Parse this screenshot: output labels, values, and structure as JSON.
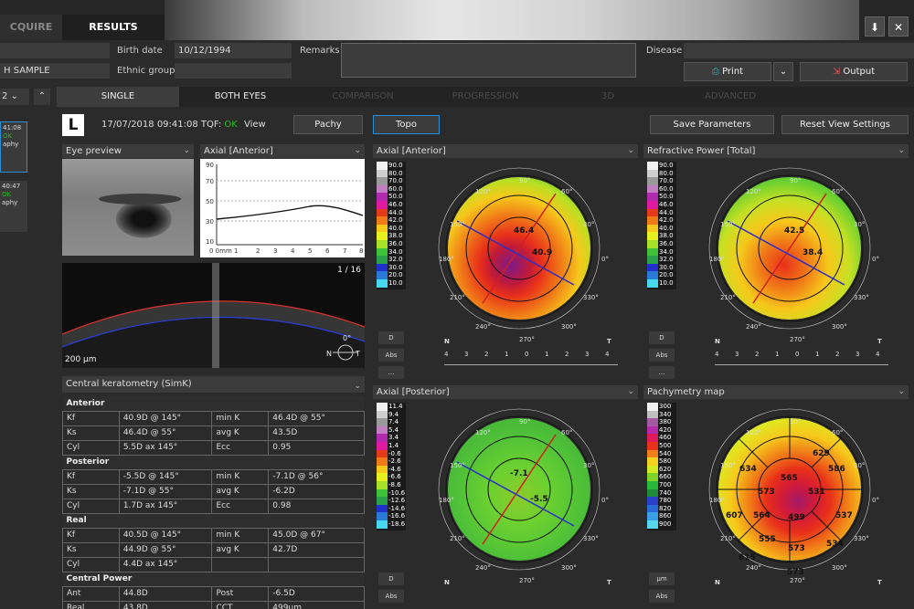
{
  "topbar": {
    "tab_acquire": "CQUIRE",
    "tab_results": "RESULTS",
    "download_icon": "⬇",
    "close_icon": "✕"
  },
  "patient": {
    "birth_label": "Birth date",
    "birth_value": "10/12/1994",
    "ethnic_label": "Ethnic group",
    "remarks_label": "Remarks",
    "disease_label": "Disease",
    "name_value": "H SAMPLE",
    "print_label": "Print",
    "output_label": "Output"
  },
  "nav": {
    "tabs": [
      "SINGLE",
      "BOTH EYES",
      "COMPARISON",
      "PROGRESSION",
      "3D",
      "ADVANCED"
    ],
    "exam_selector": "2",
    "thumb1": {
      "time": "41:08",
      "status": "OK",
      "type": "aphy"
    },
    "thumb2": {
      "time": "40:47",
      "status": "OK",
      "type": "aphy"
    }
  },
  "header": {
    "eye": "L",
    "datetime": "17/07/2018 09:41:08 TQF:",
    "tqf": "OK",
    "view": "View",
    "pachy": "Pachy",
    "topo": "Topo",
    "save": "Save Parameters",
    "reset": "Reset View Settings"
  },
  "eye_preview": {
    "title": "Eye preview"
  },
  "profile": {
    "title": "Axial [Anterior]",
    "y_ticks": [
      "90",
      "70",
      "50",
      "30",
      "10"
    ],
    "x_ticks": [
      "0 0mm 1",
      "2",
      "3",
      "4",
      "5",
      "6",
      "7",
      "8"
    ]
  },
  "oct": {
    "frame": "1 / 16",
    "scale": "200 µm",
    "angle": "0°",
    "nasal": "N",
    "temporal": "T"
  },
  "simk": {
    "title": "Central keratometry (SimK)",
    "sections": [
      {
        "name": "Anterior",
        "rows": [
          [
            "Kf",
            "40.9D @ 145°",
            "min K",
            "46.4D @ 55°"
          ],
          [
            "Ks",
            "46.4D @ 55°",
            "avg K",
            "43.5D"
          ],
          [
            "Cyl",
            "5.5D ax 145°",
            "Ecc",
            "0.95"
          ]
        ]
      },
      {
        "name": "Posterior",
        "rows": [
          [
            "Kf",
            "-5.5D @ 145°",
            "min K",
            "-7.1D @ 56°"
          ],
          [
            "Ks",
            "-7.1D @ 55°",
            "avg K",
            "-6.2D"
          ],
          [
            "Cyl",
            "1.7D ax 145°",
            "Ecc",
            "0.98"
          ]
        ]
      },
      {
        "name": "Real",
        "rows": [
          [
            "Kf",
            "40.5D @ 145°",
            "min K",
            "45.0D @ 67°"
          ],
          [
            "Ks",
            "44.9D @ 55°",
            "avg K",
            "42.7D"
          ],
          [
            "Cyl",
            "4.4D ax 145°",
            "",
            ""
          ]
        ]
      },
      {
        "name": "Central Power",
        "rows": [
          [
            "Ant",
            "44.8D",
            "Post",
            "-6.5D"
          ],
          [
            "Real",
            "43.8D",
            "CCT",
            "499µm"
          ]
        ]
      }
    ]
  },
  "maps": {
    "axial_ant": {
      "title": "Axial [Anterior]",
      "values": [
        "46.4",
        "40.9"
      ],
      "scale": [
        "90.0",
        "80.0",
        "70.0",
        "60.0",
        "50.0",
        "46.0",
        "44.0",
        "42.0",
        "40.0",
        "38.0",
        "36.0",
        "34.0",
        "32.0",
        "30.0",
        "20.0",
        "10.0"
      ],
      "btn_d": "D",
      "btn_abs": "Abs",
      "btn_more": "..."
    },
    "refr": {
      "title": "Refractive Power [Total]",
      "values": [
        "42.5",
        "38.4"
      ],
      "scale": [
        "90.0",
        "80.0",
        "70.0",
        "60.0",
        "50.0",
        "46.0",
        "44.0",
        "42.0",
        "40.0",
        "38.0",
        "36.0",
        "34.0",
        "32.0",
        "30.0",
        "20.0",
        "10.0"
      ],
      "btn_d": "D",
      "btn_abs": "Abs",
      "btn_more": "..."
    },
    "axial_post": {
      "title": "Axial [Posterior]",
      "values": [
        "-7.1",
        "-5.5"
      ],
      "scale": [
        "11.4",
        "9.4",
        "7.4",
        "5.4",
        "3.4",
        "1.4",
        "-0.6",
        "-2.6",
        "-4.6",
        "-6.6",
        "-8.6",
        "-10.6",
        "-12.6",
        "-14.6",
        "-16.6",
        "-18.6"
      ],
      "btn_d": "D",
      "btn_abs": "Abs"
    },
    "pachy": {
      "title": "Pachymetry map",
      "values": [
        "629",
        "634",
        "565",
        "586",
        "573",
        "531",
        "607",
        "564",
        "499",
        "537",
        "555",
        "573",
        "534",
        "615",
        "573"
      ],
      "scale": [
        "300",
        "340",
        "380",
        "420",
        "460",
        "500",
        "540",
        "580",
        "620",
        "660",
        "700",
        "740",
        "780",
        "820",
        "860",
        "900"
      ],
      "btn_um": "µm",
      "btn_abs": "Abs"
    },
    "compass": {
      "deg90": "90°",
      "deg120": "120°",
      "deg60": "60°",
      "deg150": "150°",
      "deg30": "30°",
      "deg180": "180°",
      "deg0": "0°",
      "deg210": "210°",
      "deg330": "330°",
      "deg240": "240°",
      "deg300": "300°",
      "deg270": "270°",
      "nasal": "N",
      "temporal": "T"
    },
    "ruler": [
      "4",
      "3",
      "2",
      "1",
      "0",
      "1",
      "2",
      "3",
      "4"
    ]
  },
  "colors": {
    "accent": "#2a8fd8",
    "ok": "#22bb22"
  }
}
